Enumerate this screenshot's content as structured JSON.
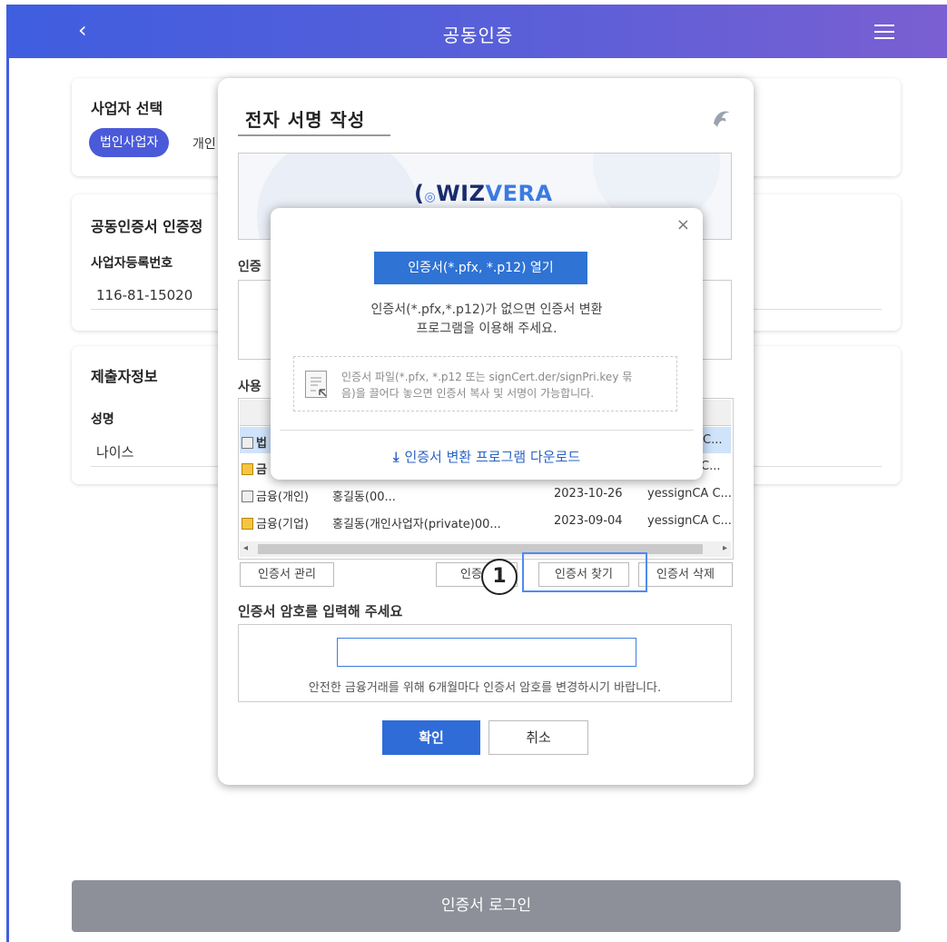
{
  "header": {
    "back_icon": "‹",
    "title": "공동인증",
    "menu_icon": "hamburger-icon"
  },
  "background": {
    "business_select": {
      "title": "사업자 선택",
      "corporate_pill": "법인사업자",
      "individual_partial": "개인"
    },
    "cert_auth": {
      "title": "공동인증서 인증정",
      "reg_label": "사업자등록번호",
      "reg_value": "116-81-15020"
    },
    "submitter": {
      "title": "제출자정보",
      "name_label": "성명",
      "name_value": "나이스"
    },
    "login_button": "인증서 로그인"
  },
  "sign_dialog": {
    "title": "전자 서명 작성",
    "banner_logo_a": "WIZ",
    "banner_logo_b": "VERA",
    "cert_location_label": "인증",
    "cert_select_label": "사용",
    "rows": [
      {
        "type": "법",
        "name": "",
        "date": "",
        "issuer": "C..."
      },
      {
        "type": "금",
        "name": "",
        "date": "",
        "issuer": "A C..."
      },
      {
        "type": "금융(개인)",
        "name": "홍길동(00...",
        "date": "2023-10-26",
        "issuer": "yessignCA C..."
      },
      {
        "type": "금융(기업)",
        "name": "홍길동(개인사업자(private)00...",
        "date": "2023-09-04",
        "issuer": "yessignCA C..."
      }
    ],
    "buttons": {
      "manage": "인증서 관리",
      "view_partial": "인증서",
      "find": "인증서 찾기",
      "delete": "인증서 삭제"
    },
    "badge_number": "1",
    "password_label": "인증서 암호를 입력해 주세요",
    "password_value": "",
    "password_hint": "안전한 금융거래를 위해 6개월마다 인증서 암호를 변경하시기 바랍니다.",
    "ok": "확인",
    "cancel": "취소"
  },
  "popup": {
    "close": "×",
    "open_button": "인증서(*.pfx, *.p12) 열기",
    "desc_line1": "인증서(*.pfx,*.p12)가 없으면 인증서 변환",
    "desc_line2": "프로그램을 이용해 주세요.",
    "drop_line1": "인증서 파일(*.pfx, *.p12 또는 signCert.der/signPri.key 묶",
    "drop_line2": "음)을 끌어다 놓으면 인증서 복사 및 서명이 가능합니다.",
    "download": "인증서 변환 프로그램 다운로드"
  }
}
